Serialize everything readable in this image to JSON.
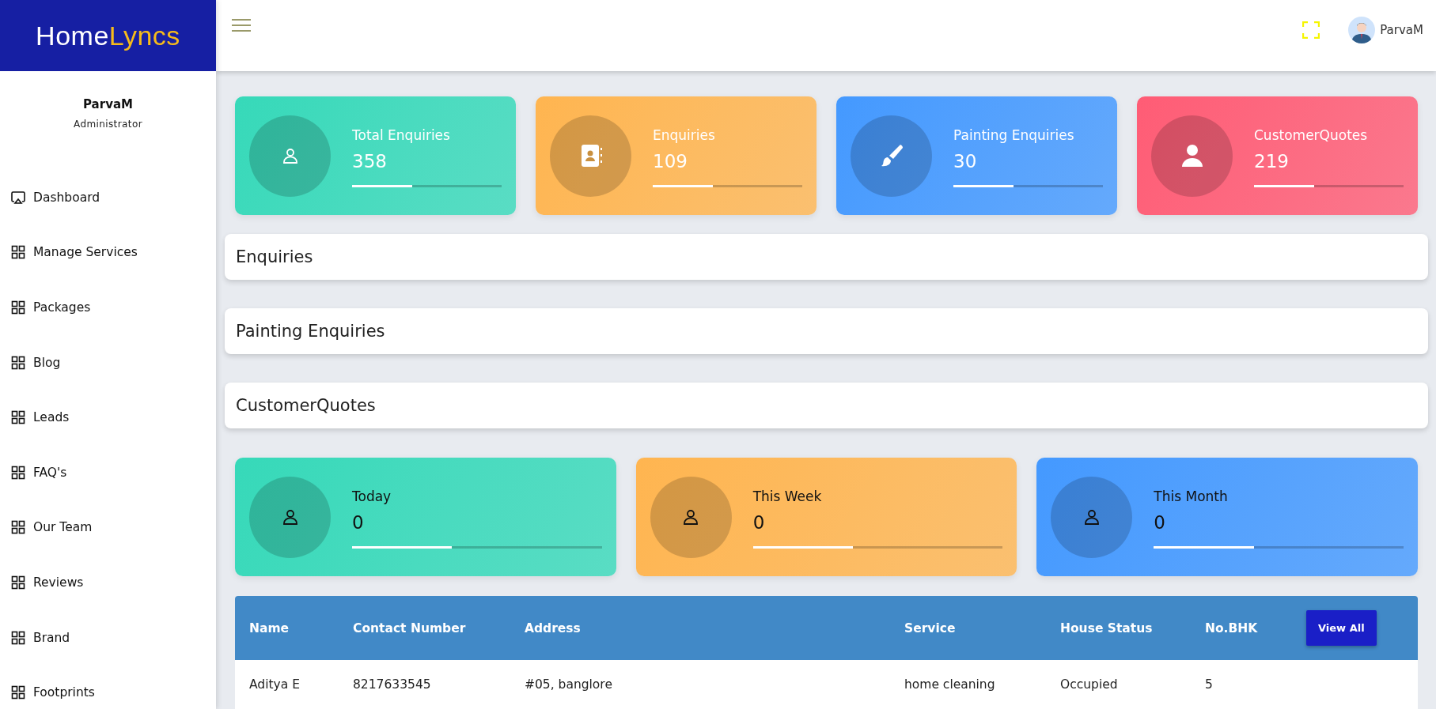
{
  "logo": {
    "first": "Home",
    "second": "Lyncs"
  },
  "header": {
    "user": "ParvaM"
  },
  "profile": {
    "name": "ParvaM",
    "role": "Administrator"
  },
  "sidebar": {
    "items": [
      {
        "label": "Dashboard",
        "kind": "dashboard"
      },
      {
        "label": "Manage Services",
        "kind": "grid"
      },
      {
        "label": "Packages",
        "kind": "grid"
      },
      {
        "label": "Blog",
        "kind": "grid"
      },
      {
        "label": "Leads",
        "kind": "grid"
      },
      {
        "label": "FAQ's",
        "kind": "grid"
      },
      {
        "label": "Our Team",
        "kind": "grid"
      },
      {
        "label": "Reviews",
        "kind": "grid"
      },
      {
        "label": "Brand",
        "kind": "grid"
      },
      {
        "label": "Footprints",
        "kind": "grid"
      }
    ]
  },
  "stat_cards": [
    {
      "title": "Total Enquiries",
      "value": "358",
      "level": 0.4,
      "color": "#36d9b9"
    },
    {
      "title": "Enquiries",
      "value": "109",
      "level": 0.4,
      "color": "#ffb550"
    },
    {
      "title": "Painting Enquiries",
      "value": "30",
      "level": 0.4,
      "color": "#4499ff"
    },
    {
      "title": "CustomerQuotes",
      "value": "219",
      "level": 0.4,
      "color": "#ff5c75"
    }
  ],
  "sections": [
    "Enquiries",
    "Painting Enquiries",
    "CustomerQuotes"
  ],
  "period_cards": [
    {
      "title": "Today",
      "value": "0",
      "level": 0.4,
      "color": "#36d9b9"
    },
    {
      "title": "This Week",
      "value": "0",
      "level": 0.4,
      "color": "#ffb550"
    },
    {
      "title": "This Month",
      "value": "0",
      "level": 0.4,
      "color": "#4499ff"
    }
  ],
  "table": {
    "columns": [
      "Name",
      "Contact Number",
      "Address",
      "Service",
      "House Status",
      "No.BHK"
    ],
    "action": "View All",
    "rows": [
      [
        "Aditya E",
        "8217633545",
        "#05, banglore",
        "home cleaning",
        "Occupied",
        "5"
      ]
    ]
  }
}
